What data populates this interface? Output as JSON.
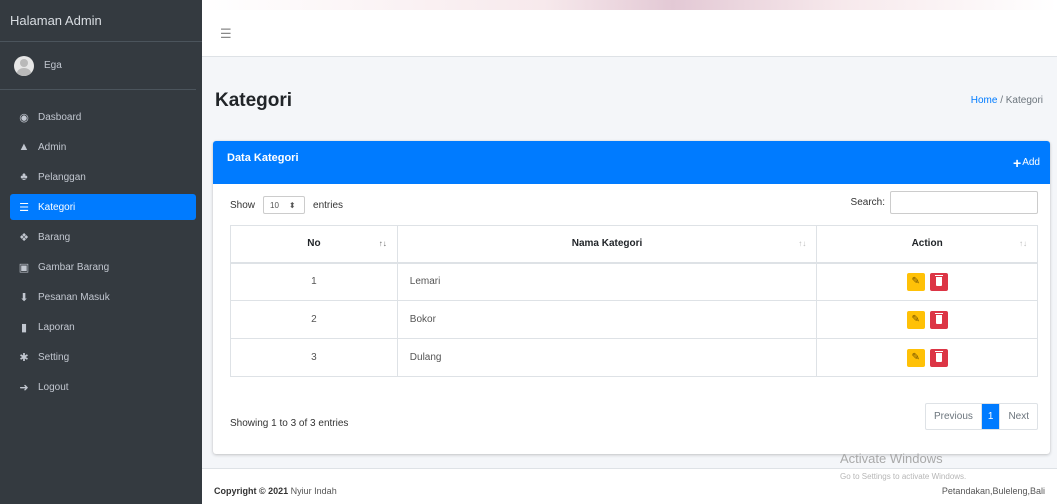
{
  "sidebar": {
    "brand": "Halaman Admin",
    "user_name": "Ega",
    "items": [
      {
        "label": "Dasboard",
        "icon": "tachometer-icon"
      },
      {
        "label": "Admin",
        "icon": "user-icon"
      },
      {
        "label": "Pelanggan",
        "icon": "users-icon"
      },
      {
        "label": "Kategori",
        "icon": "list-icon",
        "active": true
      },
      {
        "label": "Barang",
        "icon": "cubes-icon"
      },
      {
        "label": "Gambar Barang",
        "icon": "image-icon"
      },
      {
        "label": "Pesanan Masuk",
        "icon": "download-icon"
      },
      {
        "label": "Laporan",
        "icon": "file-icon"
      },
      {
        "label": "Setting",
        "icon": "gear-icon"
      },
      {
        "label": "Logout",
        "icon": "sign-out-icon"
      }
    ]
  },
  "header": {
    "menu_icon": "hamburger-icon",
    "page_title": "Kategori",
    "breadcrumb_home": "Home",
    "breadcrumb_sep": "/",
    "breadcrumb_current": "Kategori"
  },
  "card": {
    "title": "Data Kategori",
    "add_label": "Add",
    "show_label": "Show",
    "length_value": "10",
    "entries_label": "entries",
    "search_label": "Search:",
    "search_value": ""
  },
  "table": {
    "headers": [
      "No",
      "Nama Kategori",
      "Action"
    ],
    "rows": [
      {
        "no": "1",
        "name": "Lemari"
      },
      {
        "no": "2",
        "name": "Bokor"
      },
      {
        "no": "3",
        "name": "Dulang"
      }
    ]
  },
  "footer_info": {
    "info": "Showing 1 to 3 of 3 entries",
    "previous": "Previous",
    "current_page": "1",
    "next": "Next"
  },
  "footer": {
    "copyright_prefix": "Copyright © 2021",
    "copyright_name": "Nyiur Indah",
    "address": "Petandakan,Buleleng,Bali"
  },
  "watermark": {
    "line1": "Activate Windows",
    "line2": "Go to Settings to activate Windows."
  },
  "colors": {
    "primary": "#007bff",
    "sidebar": "#343a40",
    "warning": "#ffc107",
    "danger": "#dc3545"
  }
}
